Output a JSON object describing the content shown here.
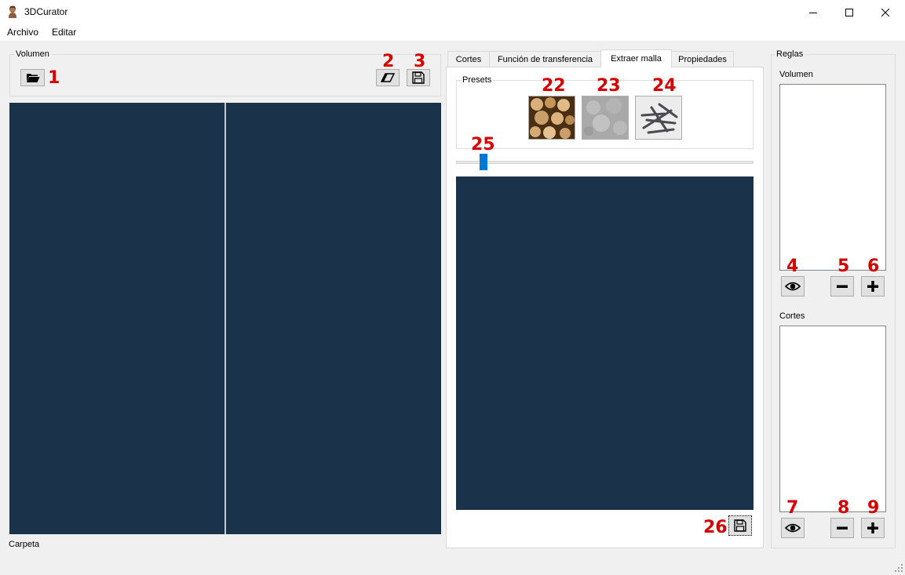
{
  "window": {
    "title": "3DCurator",
    "app_icon": "head-bust-icon",
    "controls": [
      "minimize-icon",
      "maximize-icon",
      "close-icon"
    ]
  },
  "menu": {
    "archivo": "Archivo",
    "editar": "Editar"
  },
  "left_panel": {
    "group_title": "Volumen",
    "open_icon": "folder-open-icon",
    "erase_icon": "eraser-icon",
    "save_icon": "save-icon",
    "status_label": "Carpeta",
    "view_color": "#1b324b"
  },
  "tabs": [
    {
      "label": "Cortes",
      "active": false
    },
    {
      "label": "Función de transferencia",
      "active": false
    },
    {
      "label": "Extraer malla",
      "active": true
    },
    {
      "label": "Propiedades",
      "active": false
    }
  ],
  "extract_tab": {
    "presets_title": "Presets",
    "presets": [
      "wood-preset-icon",
      "stone-preset-icon",
      "nails-preset-icon"
    ],
    "slider_value": 0.08,
    "save_icon": "save-icon"
  },
  "rules_panel": {
    "group_title": "Reglas",
    "volumen_label": "Volumen",
    "cortes_label": "Cortes",
    "view_icon": "eye-icon",
    "remove_icon": "minus-icon",
    "add_icon": "plus-icon"
  },
  "annotations": {
    "n1": "1",
    "n2": "2",
    "n3": "3",
    "n4": "4",
    "n5": "5",
    "n6": "6",
    "n7": "7",
    "n8": "8",
    "n9": "9",
    "n22": "22",
    "n23": "23",
    "n24": "24",
    "n25": "25",
    "n26": "26",
    "color": "#d40000"
  }
}
